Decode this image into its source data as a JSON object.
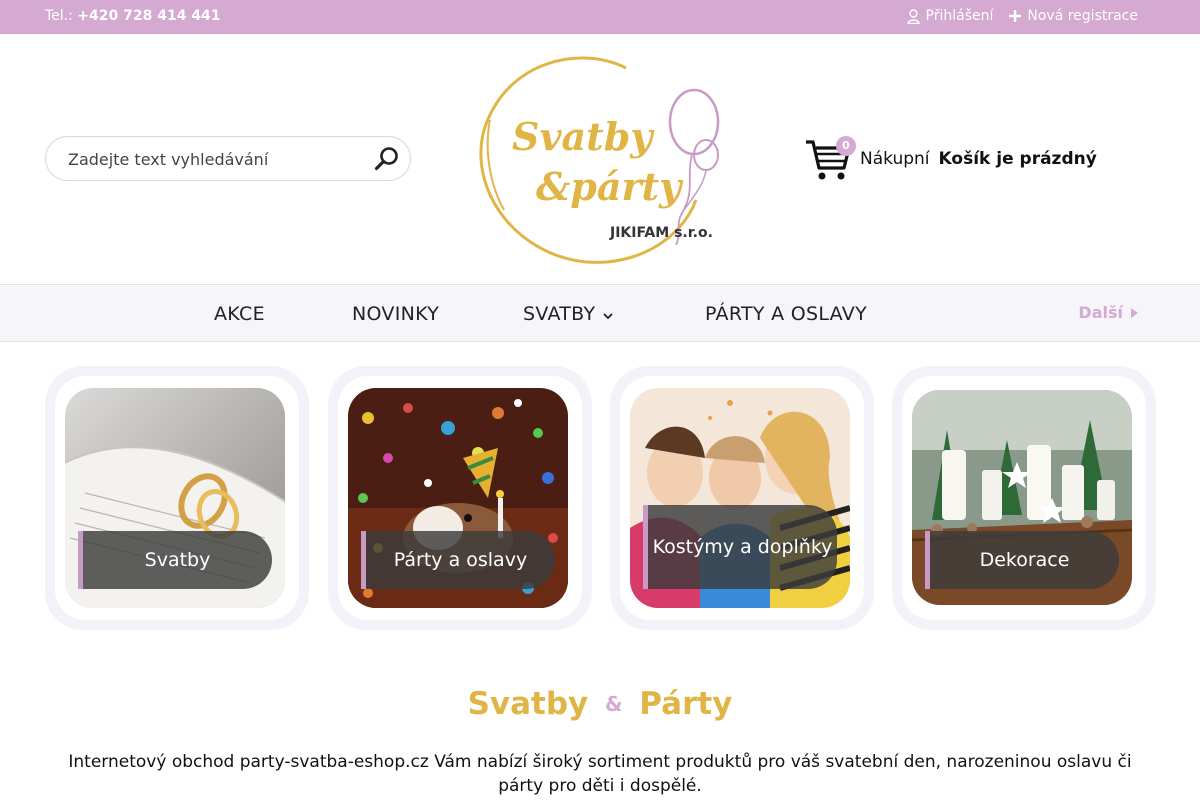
{
  "topbar": {
    "phone_label": "Tel.:",
    "phone": "+420 728 414 441",
    "login": "Přihlášení",
    "register": "Nová registrace"
  },
  "search": {
    "placeholder": "Zadejte text vyhledávání"
  },
  "logo": {
    "line1": "Svatby",
    "line2": "&párty",
    "company": "JIKIFAM s.r.o."
  },
  "cart": {
    "count": "0",
    "label": "Nákupní",
    "status": "Košík je prázdný"
  },
  "nav": {
    "items": [
      "AKCE",
      "NOVINKY",
      "SVATBY",
      "PÁRTY A OSLAVY"
    ],
    "more": "Další"
  },
  "tiles": [
    {
      "label": "Svatby"
    },
    {
      "label": "Párty a oslavy"
    },
    {
      "label": "Kostýmy a doplňky"
    },
    {
      "label": "Dekorace"
    }
  ],
  "intro": {
    "title_left": "Svatby",
    "title_amp": "&",
    "title_right": "Párty",
    "text": "Internetový obchod party-svatba-eshop.cz Vám nabízí široký sortiment produktů pro váš svatební den, narozeninou oslavu či párty pro děti i dospělé."
  },
  "colors": {
    "accent_pink": "#d4a9d2",
    "accent_gold": "#e0b545"
  }
}
